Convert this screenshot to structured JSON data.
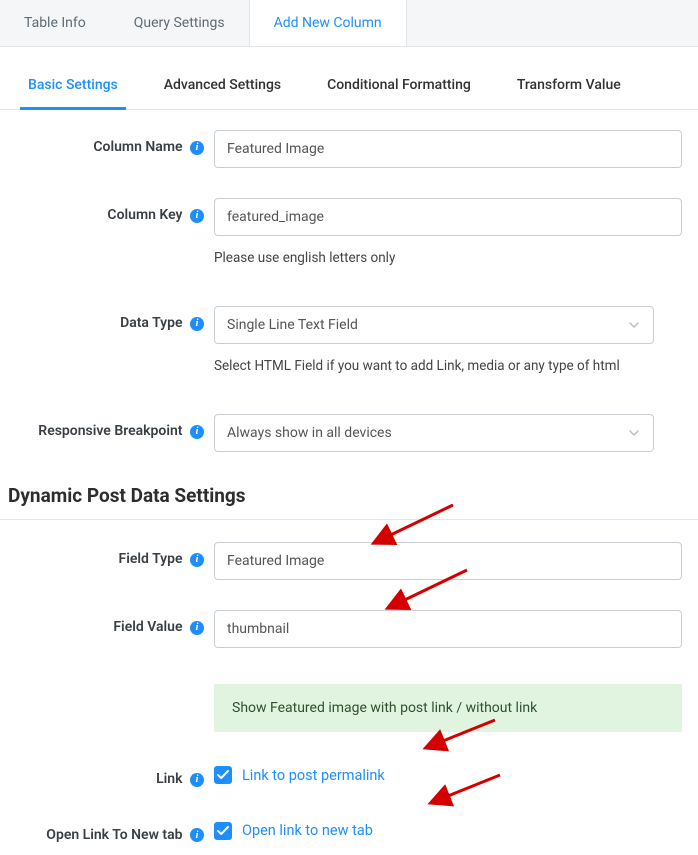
{
  "top_tabs": {
    "table_info": "Table Info",
    "query_settings": "Query Settings",
    "add_new_column": "Add New Column"
  },
  "sub_tabs": {
    "basic": "Basic Settings",
    "advanced": "Advanced Settings",
    "conditional": "Conditional Formatting",
    "transform": "Transform Value"
  },
  "fields": {
    "column_name": {
      "label": "Column Name",
      "value": "Featured Image"
    },
    "column_key": {
      "label": "Column Key",
      "value": "featured_image",
      "help": "Please use english letters only"
    },
    "data_type": {
      "label": "Data Type",
      "value": "Single Line Text Field",
      "help": "Select HTML Field if you want to add Link, media or any type of html"
    },
    "responsive": {
      "label": "Responsive Breakpoint",
      "value": "Always show in all devices"
    }
  },
  "dynamic_section": {
    "title": "Dynamic Post Data Settings",
    "field_type": {
      "label": "Field Type",
      "value": "Featured Image"
    },
    "field_value": {
      "label": "Field Value",
      "value": "thumbnail"
    },
    "banner": "Show Featured image with post link / without link",
    "link": {
      "label": "Link",
      "checkbox_label": "Link to post permalink",
      "checked": true
    },
    "new_tab": {
      "label": "Open Link To New tab",
      "checkbox_label": "Open link to new tab",
      "checked": true
    }
  }
}
